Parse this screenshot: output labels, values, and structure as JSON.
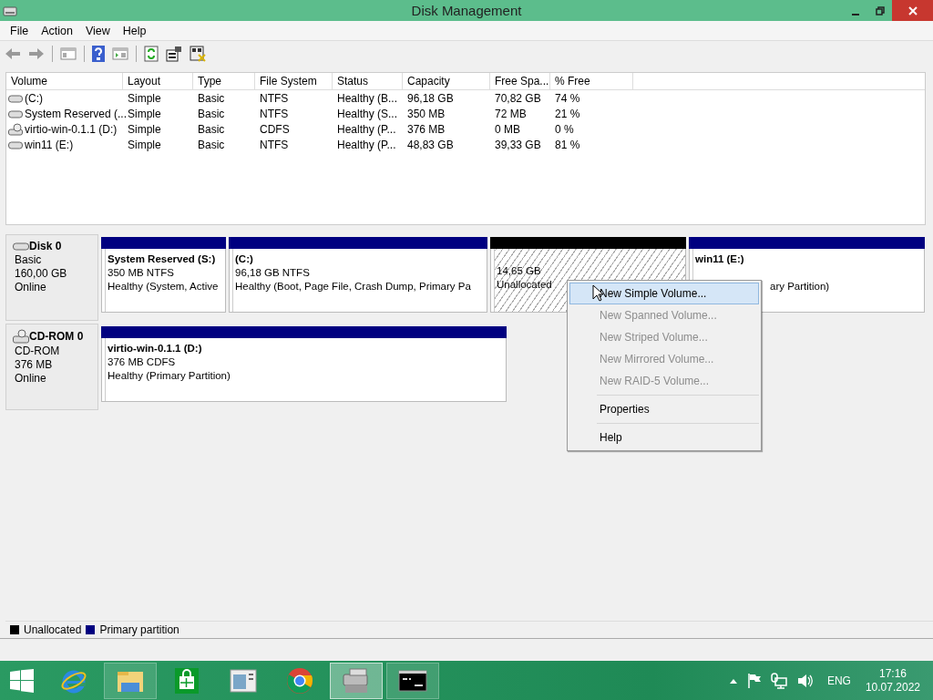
{
  "window": {
    "title": "Disk Management"
  },
  "menu": [
    "File",
    "Action",
    "View",
    "Help"
  ],
  "table": {
    "columns": [
      "Volume",
      "Layout",
      "Type",
      "File System",
      "Status",
      "Capacity",
      "Free Spa...",
      "% Free"
    ],
    "rows": [
      {
        "kind": "disk",
        "cells": [
          "(C:)",
          "Simple",
          "Basic",
          "NTFS",
          "Healthy (B...",
          "96,18 GB",
          "70,82 GB",
          "74 %"
        ]
      },
      {
        "kind": "disk",
        "cells": [
          "System Reserved (...",
          "Simple",
          "Basic",
          "NTFS",
          "Healthy (S...",
          "350 MB",
          "72 MB",
          "21 %"
        ]
      },
      {
        "kind": "cdrom",
        "cells": [
          "virtio-win-0.1.1 (D:)",
          "Simple",
          "Basic",
          "CDFS",
          "Healthy (P...",
          "376 MB",
          "0 MB",
          "0 %"
        ]
      },
      {
        "kind": "disk",
        "cells": [
          "win11 (E:)",
          "Simple",
          "Basic",
          "NTFS",
          "Healthy (P...",
          "48,83 GB",
          "39,33 GB",
          "81 %"
        ]
      }
    ]
  },
  "disks": [
    {
      "kind": "disk",
      "name": "Disk 0",
      "type": "Basic",
      "size": "160,00 GB",
      "status": "Online",
      "partitions": [
        {
          "kind": "primary",
          "title": "System Reserved  (S:)",
          "detail": "350 MB NTFS",
          "status": "Healthy (System, Active"
        },
        {
          "kind": "primary",
          "title": " (C:)",
          "detail": "96,18 GB NTFS",
          "status": "Healthy (Boot, Page File, Crash Dump, Primary Pa"
        },
        {
          "kind": "unallocated",
          "detail": "14,65 GB",
          "status": "Unallocated"
        },
        {
          "kind": "primary",
          "title": "win11  (E:)",
          "status": "ary Partition)"
        }
      ]
    },
    {
      "kind": "cdrom",
      "name": "CD-ROM 0",
      "type": "CD-ROM",
      "size": "376 MB",
      "status": "Online",
      "partitions": [
        {
          "kind": "primary",
          "title": "virtio-win-0.1.1  (D:)",
          "detail": "376 MB CDFS",
          "status": "Healthy (Primary Partition)"
        }
      ]
    }
  ],
  "context_menu": [
    {
      "kind": "item",
      "label": "New Simple Volume...",
      "disabled": false,
      "selected": true
    },
    {
      "kind": "item",
      "label": "New Spanned Volume...",
      "disabled": true,
      "selected": false
    },
    {
      "kind": "item",
      "label": "New Striped Volume...",
      "disabled": true,
      "selected": false
    },
    {
      "kind": "item",
      "label": "New Mirrored Volume...",
      "disabled": true,
      "selected": false
    },
    {
      "kind": "item",
      "label": "New RAID-5 Volume...",
      "disabled": true,
      "selected": false
    },
    {
      "kind": "separator"
    },
    {
      "kind": "item",
      "label": "Properties",
      "disabled": false,
      "selected": false
    },
    {
      "kind": "separator"
    },
    {
      "kind": "item",
      "label": "Help",
      "disabled": false,
      "selected": false
    }
  ],
  "legend": [
    {
      "label": "Unallocated",
      "color": "#000000"
    },
    {
      "label": "Primary partition",
      "color": "#000080"
    }
  ],
  "taskbar": {
    "apps": [
      {
        "kind": "ie",
        "running": false,
        "selected": false
      },
      {
        "kind": "explorer",
        "running": true,
        "selected": false
      },
      {
        "kind": "store",
        "running": false,
        "selected": false
      },
      {
        "kind": "window",
        "running": false,
        "selected": false
      },
      {
        "kind": "chrome",
        "running": false,
        "selected": false
      },
      {
        "kind": "diskmgmt",
        "running": true,
        "selected": true
      },
      {
        "kind": "cmd",
        "running": true,
        "selected": false
      }
    ],
    "language": "ENG",
    "time": "17:16",
    "date": "10.07.2022"
  }
}
